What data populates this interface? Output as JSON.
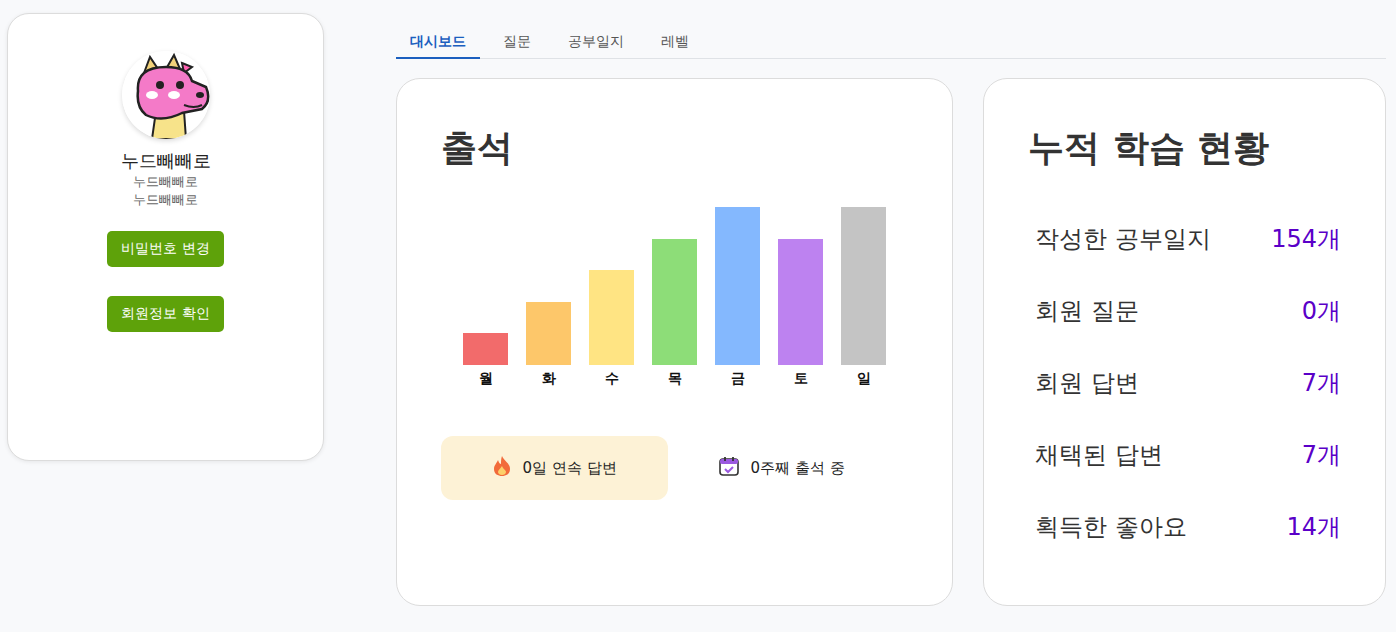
{
  "profile": {
    "nickname": "누드빼빼로",
    "line1": "누드빼빼로",
    "line2": "누드빼빼로",
    "buttons": [
      "비밀번호 변경",
      "회원정보 확인"
    ]
  },
  "tabs": [
    {
      "label": "대시보드",
      "selected": true
    },
    {
      "label": "질문",
      "selected": false
    },
    {
      "label": "공부일지",
      "selected": false
    },
    {
      "label": "레벨",
      "selected": false
    }
  ],
  "attendance": {
    "title": "출석",
    "bars": [
      {
        "day": "월",
        "value": 1,
        "color": "#f26b6b"
      },
      {
        "day": "화",
        "value": 2,
        "color": "#fdc76a"
      },
      {
        "day": "수",
        "value": 3,
        "color": "#ffe483"
      },
      {
        "day": "목",
        "value": 4,
        "color": "#8ddd78"
      },
      {
        "day": "금",
        "value": 5,
        "color": "#84b8fe"
      },
      {
        "day": "토",
        "value": 4,
        "color": "#bd82f0"
      },
      {
        "day": "일",
        "value": 5,
        "color": "#c4c4c4"
      }
    ],
    "streak": "0일 연속 답변",
    "weeks": "0주째 출석 중"
  },
  "stats": {
    "title": "누적 학습 현황",
    "rows": [
      {
        "label": "작성한 공부일지",
        "value": "154개"
      },
      {
        "label": "회원 질문",
        "value": "0개"
      },
      {
        "label": "회원 답변",
        "value": "7개"
      },
      {
        "label": "채택된 답변",
        "value": "7개"
      },
      {
        "label": "획득한 좋아요",
        "value": "14개"
      }
    ]
  }
}
